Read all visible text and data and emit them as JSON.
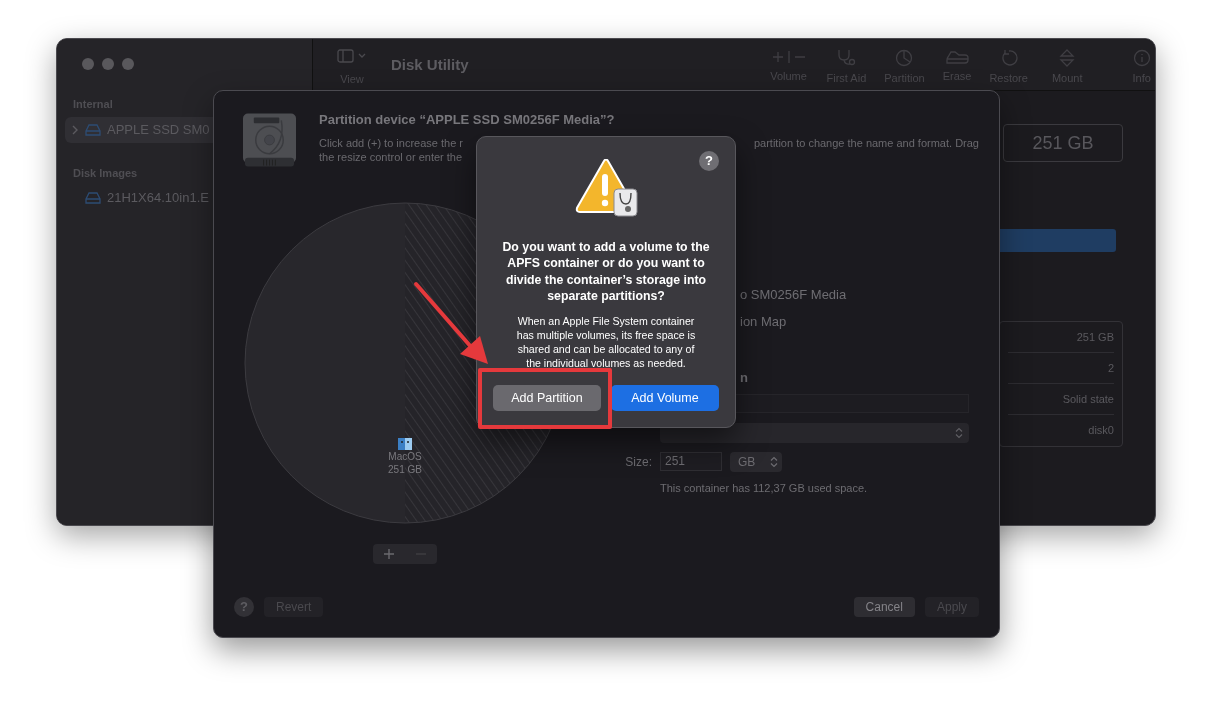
{
  "main_window": {
    "title": "Disk Utility",
    "toolbar": {
      "view_label": "View",
      "items": [
        {
          "kind": "volume",
          "label": "Volume"
        },
        {
          "kind": "firstaid",
          "label": "First Aid"
        },
        {
          "kind": "partition",
          "label": "Partition"
        },
        {
          "kind": "erase",
          "label": "Erase"
        },
        {
          "kind": "restore",
          "label": "Restore"
        },
        {
          "kind": "mount",
          "label": "Mount"
        },
        {
          "kind": "info",
          "label": "Info"
        }
      ]
    },
    "sidebar": {
      "sections": [
        {
          "header": "Internal",
          "items": [
            {
              "label": "APPLE SSD SM0",
              "selected": true
            }
          ]
        },
        {
          "header": "Disk Images",
          "items": [
            {
              "label": "21H1X64.10in1.E",
              "selected": false
            }
          ]
        }
      ]
    },
    "capacity": "251 GB",
    "info_values": [
      "251 GB",
      "2",
      "Solid state",
      "disk0"
    ]
  },
  "sheet": {
    "title": "Partition device “APPLE SSD SM0256F Media”?",
    "description_left": [
      "Click add (+) to increase the r",
      "the resize control or enter the"
    ],
    "description_right": "partition to change the name and format. Drag",
    "pie": {
      "label": "MacOS",
      "size": "251 GB"
    },
    "details": [
      "o SM0256F Media",
      "ion Map"
    ],
    "section_heading": "n",
    "size_label": "Size:",
    "size_value": "251",
    "size_unit": "GB",
    "note": "This container has 112,37 GB used space.",
    "help": "?",
    "buttons": [
      {
        "label": "Revert",
        "disabled": true
      },
      {
        "label": "Cancel",
        "disabled": false
      },
      {
        "label": "Apply",
        "disabled": true
      }
    ]
  },
  "alert": {
    "help": "?",
    "title": "Do you want to add a volume to the APFS container or do you want to divide the container’s storage into separate partitions?",
    "message": "When an Apple File System container has multiple volumes, its free space is shared and can be allocated to any of the individual volumes as needed.",
    "buttons": [
      {
        "label": "Add Partition",
        "default": false
      },
      {
        "label": "Add Volume",
        "default": true
      }
    ]
  }
}
